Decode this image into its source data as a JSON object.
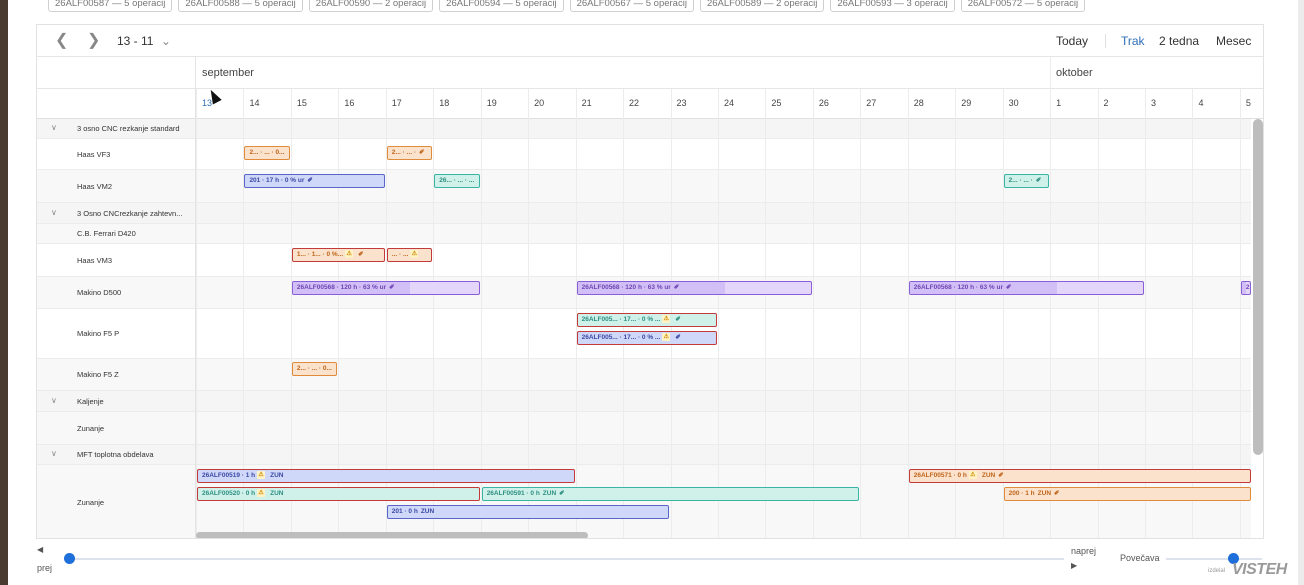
{
  "chips": [
    "26ALF00587 — 5 operacij",
    "26ALF00588 — 5 operacij",
    "26ALF00590 — 2 operacij",
    "26ALF00594 — 5 operacij",
    "26ALF00567 — 5 operacij",
    "26ALF00589 — 2 operacij",
    "26ALF00593 — 3 operacij",
    "26ALF00572 — 5 operacij"
  ],
  "toolbar": {
    "prev_icon": "chevron-left-icon",
    "next_icon": "chevron-right-icon",
    "range": "13 - 11",
    "range_dropdown_icon": "chevron-down-icon",
    "today": "Today",
    "views": [
      "Trak",
      "2 tedna",
      "Mesec"
    ],
    "active_view": "Trak"
  },
  "months": [
    "september",
    "oktober"
  ],
  "days": [
    "13",
    "14",
    "15",
    "16",
    "17",
    "18",
    "19",
    "20",
    "21",
    "22",
    "23",
    "24",
    "25",
    "26",
    "27",
    "28",
    "29",
    "30",
    "1",
    "2",
    "3",
    "4",
    "5"
  ],
  "today_day": "13",
  "rows": [
    {
      "type": "group",
      "label": "3 osno CNC rezkanje standard"
    },
    {
      "type": "resource",
      "label": "Haas VF3"
    },
    {
      "type": "resource",
      "label": "Haas VM2"
    },
    {
      "type": "group",
      "label": "3 Osno CNCrezkanje zahtevn..."
    },
    {
      "type": "resource",
      "label": "C.B. Ferrari D420"
    },
    {
      "type": "resource",
      "label": "Haas VM3"
    },
    {
      "type": "resource",
      "label": "Makino D500"
    },
    {
      "type": "resource",
      "label": "Makino F5 P"
    },
    {
      "type": "resource",
      "label": "Makino F5 Z"
    },
    {
      "type": "group",
      "label": "Kaljenje"
    },
    {
      "type": "resource",
      "label": "Zunanje"
    },
    {
      "type": "group",
      "label": "MFT toplotna obdelava"
    },
    {
      "type": "resource",
      "label": "Zunanje"
    }
  ],
  "events": [
    {
      "row": 1,
      "start": 1,
      "end": 2,
      "lane": 0,
      "color": "orange",
      "text": "2... · ... · 0...",
      "warn": false,
      "pin": false
    },
    {
      "row": 1,
      "start": 4,
      "end": 5,
      "lane": 0,
      "color": "orange",
      "text": "2... · ... ·",
      "warn": false,
      "pin": true
    },
    {
      "row": 2,
      "start": 1,
      "end": 4,
      "lane": 0,
      "color": "blue",
      "text": "201 · 17 h · 0 % ur",
      "warn": false,
      "pin": true
    },
    {
      "row": 2,
      "start": 5,
      "end": 6,
      "lane": 0,
      "color": "teal",
      "text": "26... · ... · ...",
      "warn": false,
      "pin": false
    },
    {
      "row": 2,
      "start": 17,
      "end": 18,
      "lane": 0,
      "color": "teal",
      "text": "2... · ... ·",
      "warn": false,
      "pin": true
    },
    {
      "row": 5,
      "start": 2,
      "end": 4,
      "lane": 0,
      "color": "orange",
      "red": true,
      "text": "1... · 1... · 0 %...",
      "warn": true,
      "pin": true
    },
    {
      "row": 5,
      "start": 4,
      "end": 5,
      "lane": 0,
      "color": "orange",
      "red": true,
      "text": "... · ...",
      "warn": true,
      "pin": false
    },
    {
      "row": 6,
      "start": 2,
      "end": 6,
      "lane": 0,
      "color": "purple",
      "progress": 0.63,
      "text": "26ALF00568 · 120 h · 63 % ur",
      "warn": false,
      "pin": true
    },
    {
      "row": 6,
      "start": 8,
      "end": 13,
      "lane": 0,
      "color": "purple",
      "progress": 0.63,
      "text": "26ALF00568 · 120 h · 63 % ur",
      "warn": false,
      "pin": true
    },
    {
      "row": 6,
      "start": 15,
      "end": 20,
      "lane": 0,
      "color": "purple",
      "progress": 0.63,
      "text": "26ALF00568 · 120 h · 63 % ur",
      "warn": false,
      "pin": true
    },
    {
      "row": 6,
      "start": 22,
      "end": 23,
      "lane": 0,
      "color": "purple",
      "progress": 0.5,
      "text": "2...",
      "warn": false,
      "pin": false
    },
    {
      "row": 7,
      "start": 8,
      "end": 11,
      "lane": 0,
      "color": "teal",
      "red": true,
      "text": "26ALF005... · 17... · 0 % ...",
      "warn": true,
      "pin": true
    },
    {
      "row": 7,
      "start": 8,
      "end": 11,
      "lane": 1,
      "color": "blue",
      "red": true,
      "text": "26ALF005... · 17... · 0 % ...",
      "warn": true,
      "pin": true
    },
    {
      "row": 8,
      "start": 2,
      "end": 3,
      "lane": 0,
      "color": "orange",
      "text": "2... · ... · 0...",
      "warn": false,
      "pin": false
    },
    {
      "row": 12,
      "start": 0,
      "end": 8,
      "lane": 0,
      "color": "blue",
      "red": true,
      "text": "26ALF00519 · 1 h",
      "warn": true,
      "tag": "ZUN",
      "pin": false
    },
    {
      "row": 12,
      "start": 15,
      "end": 23,
      "lane": 0,
      "color": "orange",
      "red": true,
      "text": "26ALF00571 · 0 h",
      "warn": true,
      "tag": "ZUN",
      "pin": true
    },
    {
      "row": 12,
      "start": 0,
      "end": 6,
      "lane": 1,
      "color": "teal",
      "red": true,
      "text": "26ALF00520 · 0 h",
      "warn": true,
      "tag": "ZUN",
      "pin": false
    },
    {
      "row": 12,
      "start": 6,
      "end": 14,
      "lane": 1,
      "color": "teal",
      "text": "26ALF00591 · 0 h",
      "tag": "ZUN",
      "warn": false,
      "pin": true
    },
    {
      "row": 12,
      "start": 17,
      "end": 23,
      "lane": 1,
      "color": "orange",
      "text": "200 · 1 h",
      "tag": "ZUN",
      "warn": false,
      "pin": true
    },
    {
      "row": 12,
      "start": 4,
      "end": 10,
      "lane": 2,
      "color": "blue",
      "text": "201 · 0 h",
      "tag": "ZUN",
      "warn": false,
      "pin": false
    }
  ],
  "bottom": {
    "prev_label": "prej",
    "prev_icon": "caret-left-icon",
    "next_label": "naprej",
    "next_icon": "caret-right-icon",
    "zoom_label": "Povečava",
    "brand_small": "izdelal",
    "brand": "VISTEH"
  },
  "timeline_position": 0.0,
  "zoom_level": 0.7
}
